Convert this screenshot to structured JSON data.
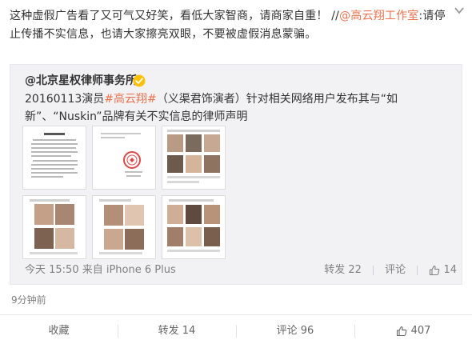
{
  "post": {
    "text_main": "这种虚假广告看了又可气又好笑，看低大家智商，请商家自重！ //",
    "mention": "@高云翔工作室",
    "text_after_mention": ":请停止传播不实信息，也请大家擦亮双眼，不要被虚假消息蒙骗。",
    "time": "9分钟前"
  },
  "repost": {
    "author": "@北京星权律师事务所",
    "text_prefix": "20160113演员",
    "topic": "#高云翔#",
    "text_suffix": "（义渠君饰演者）针对相关网络用户发布其与“如新”、“Nuskin”品牌有关不实信息的律师声明",
    "time_source": "今天 15:50 来自 iPhone 6 Plus",
    "repost_label": "转发 22",
    "comment_label": "评论",
    "like_count": "14"
  },
  "actions": {
    "favorite": "收藏",
    "repost": "转发 14",
    "comment": "评论 96",
    "like": "407"
  },
  "colors": {
    "link": "#eb7350",
    "verified": "#ffc000",
    "repost_bg": "#f2f2f5"
  },
  "icons": {
    "menu": "chevron-down-icon",
    "verified": "verified-badge-icon",
    "like": "thumbs-up-icon"
  }
}
